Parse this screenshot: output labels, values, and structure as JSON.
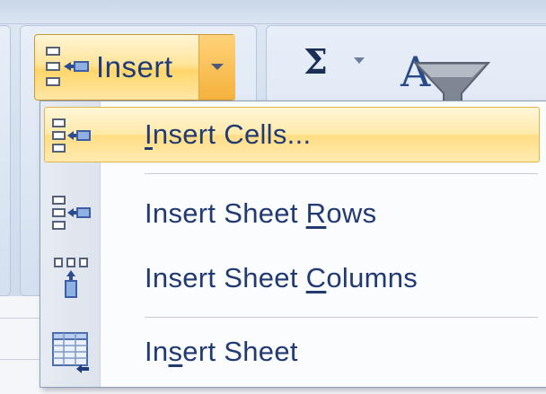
{
  "ribbon": {
    "insert_button": {
      "label": "Insert",
      "icon": "insert-cells-icon",
      "dropdown_icon": "chevron-down-icon"
    },
    "sum_button": {
      "glyph": "Σ",
      "icon": "autosum-icon"
    },
    "sort_filter_button": {
      "icon": "sort-filter-icon"
    }
  },
  "insert_menu": {
    "items": [
      {
        "pre": "",
        "key": "I",
        "post": "nsert Cells...",
        "icon": "insert-cells-icon",
        "highlighted": true
      },
      {
        "pre": "Insert Sheet ",
        "key": "R",
        "post": "ows",
        "icon": "insert-rows-icon",
        "highlighted": false
      },
      {
        "pre": "Insert Sheet ",
        "key": "C",
        "post": "olumns",
        "icon": "insert-columns-icon",
        "highlighted": false
      },
      {
        "pre": "In",
        "key": "s",
        "post": "ert Sheet",
        "icon": "insert-sheet-icon",
        "highlighted": false
      }
    ]
  },
  "colors": {
    "menu_text": "#223a73",
    "highlight": "#ffe9a8",
    "ribbon_bg": "#d7e2f0"
  }
}
